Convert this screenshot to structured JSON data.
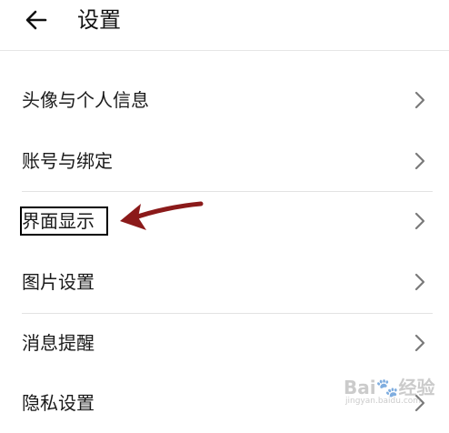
{
  "header": {
    "title": "设置",
    "back_icon": "arrow-left-icon"
  },
  "settings": {
    "items": [
      {
        "label": "头像与个人信息"
      },
      {
        "label": "账号与绑定"
      },
      {
        "label": "界面显示"
      },
      {
        "label": "图片设置"
      },
      {
        "label": "消息提醒"
      },
      {
        "label": "隐私设置"
      }
    ]
  },
  "annotation": {
    "arrow_color": "#8b1a1a",
    "box_color": "#000000"
  },
  "watermark": {
    "logo": "Bai🐾经验",
    "sub": "jingyan.baidu.com"
  }
}
